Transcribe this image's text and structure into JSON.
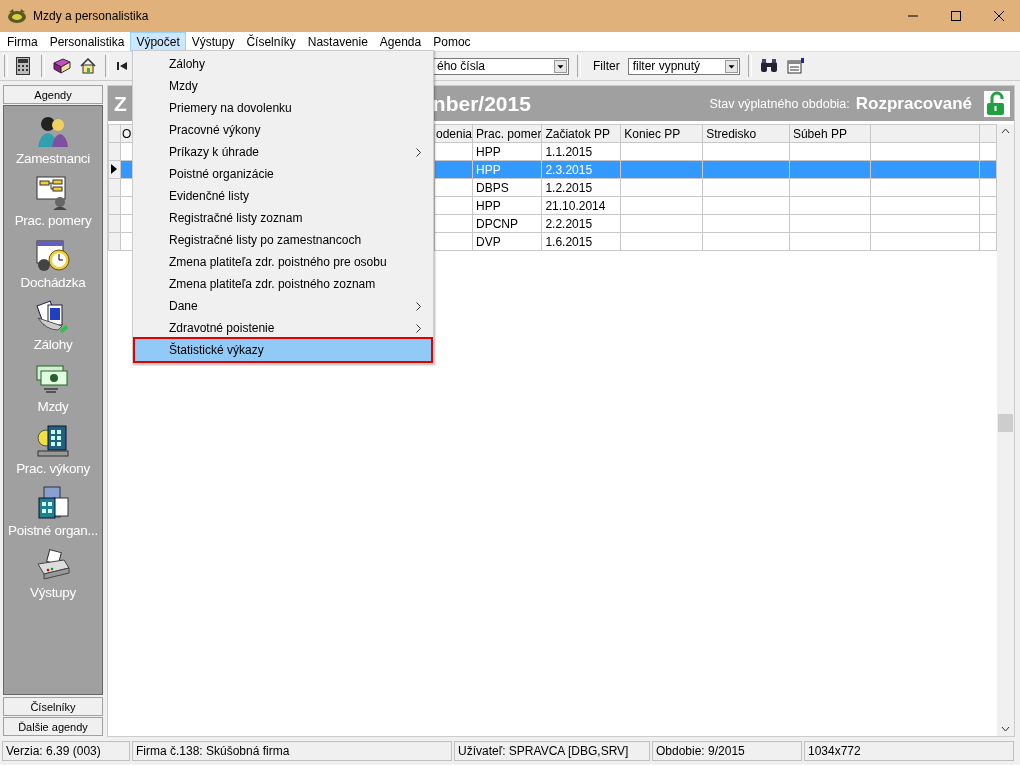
{
  "window": {
    "title": "Mzdy a personalistika"
  },
  "menubar": [
    {
      "label": "Firma",
      "selected": false
    },
    {
      "label": "Personalistika",
      "selected": false
    },
    {
      "label": "Výpočet",
      "selected": true
    },
    {
      "label": "Výstupy",
      "selected": false
    },
    {
      "label": "Číselníky",
      "selected": false
    },
    {
      "label": "Nastavenie",
      "selected": false
    },
    {
      "label": "Agenda",
      "selected": false
    },
    {
      "label": "Pomoc",
      "selected": false
    }
  ],
  "dropdown_menu": [
    {
      "label": "Zálohy",
      "submenu": false,
      "selected": false
    },
    {
      "label": "Mzdy",
      "submenu": false,
      "selected": false
    },
    {
      "label": "Priemery na dovolenku",
      "submenu": false,
      "selected": false
    },
    {
      "label": "Pracovné výkony",
      "submenu": false,
      "selected": false
    },
    {
      "label": "Príkazy k úhrade",
      "submenu": true,
      "selected": false
    },
    {
      "label": "Poistné organizácie",
      "submenu": false,
      "selected": false
    },
    {
      "label": "Evidenčné listy",
      "submenu": false,
      "selected": false
    },
    {
      "label": "Registračné listy zoznam",
      "submenu": false,
      "selected": false
    },
    {
      "label": "Registračné listy po zamestnancoch",
      "submenu": false,
      "selected": false
    },
    {
      "label": "Zmena platiteľa zdr. poistného pre osobu",
      "submenu": false,
      "selected": false
    },
    {
      "label": "Zmena platiteľa zdr. poistného zoznam",
      "submenu": false,
      "selected": false
    },
    {
      "label": "Dane",
      "submenu": true,
      "selected": false
    },
    {
      "label": "Zdravotné poistenie",
      "submenu": true,
      "selected": false
    },
    {
      "label": "Štatistické výkazy",
      "submenu": false,
      "selected": true
    }
  ],
  "toolbar": {
    "sort_field": {
      "value": "ého čísla"
    },
    "filter_label": "Filter",
    "filter_field": {
      "value": "filter vypnutý"
    }
  },
  "sidebar": {
    "header": "Agendy",
    "items": [
      {
        "label": "Zamestnanci"
      },
      {
        "label": "Prac. pomery"
      },
      {
        "label": "Dochádzka"
      },
      {
        "label": "Zálohy"
      },
      {
        "label": "Mzdy"
      },
      {
        "label": "Prac. výkony"
      },
      {
        "label": "Poistné organ..."
      },
      {
        "label": "Výstupy"
      }
    ],
    "footer_buttons": [
      "Číselníky",
      "Ďalšie agendy"
    ]
  },
  "header": {
    "title_start": "Z",
    "title_end": "nber/2015",
    "status_label": "Stav výplatného obdobia:",
    "status_value": "Rozpracované"
  },
  "table": {
    "columns": [
      "O",
      "odenia",
      "Prac. pomer",
      "Začiatok PP",
      "Koniec PP",
      "Stredisko",
      "Súbeh PP"
    ],
    "rows": [
      {
        "selected": false,
        "cells": [
          "HPP",
          "1.1.2015"
        ]
      },
      {
        "selected": true,
        "cells": [
          "HPP",
          "2.3.2015"
        ]
      },
      {
        "selected": false,
        "cells": [
          "DBPS",
          "1.2.2015"
        ]
      },
      {
        "selected": false,
        "cells": [
          "HPP",
          "21.10.2014"
        ]
      },
      {
        "selected": false,
        "cells": [
          "DPCNP",
          "2.2.2015"
        ]
      },
      {
        "selected": false,
        "cells": [
          "DVP",
          "1.6.2015"
        ]
      }
    ]
  },
  "status_bar": [
    "Verzia: 6.39 (003)",
    "Firma č.138: Skúšobná firma",
    "Užívateľ: SPRAVCA [DBG,SRV]",
    "Obdobie: 9/2015",
    "1034x772"
  ]
}
